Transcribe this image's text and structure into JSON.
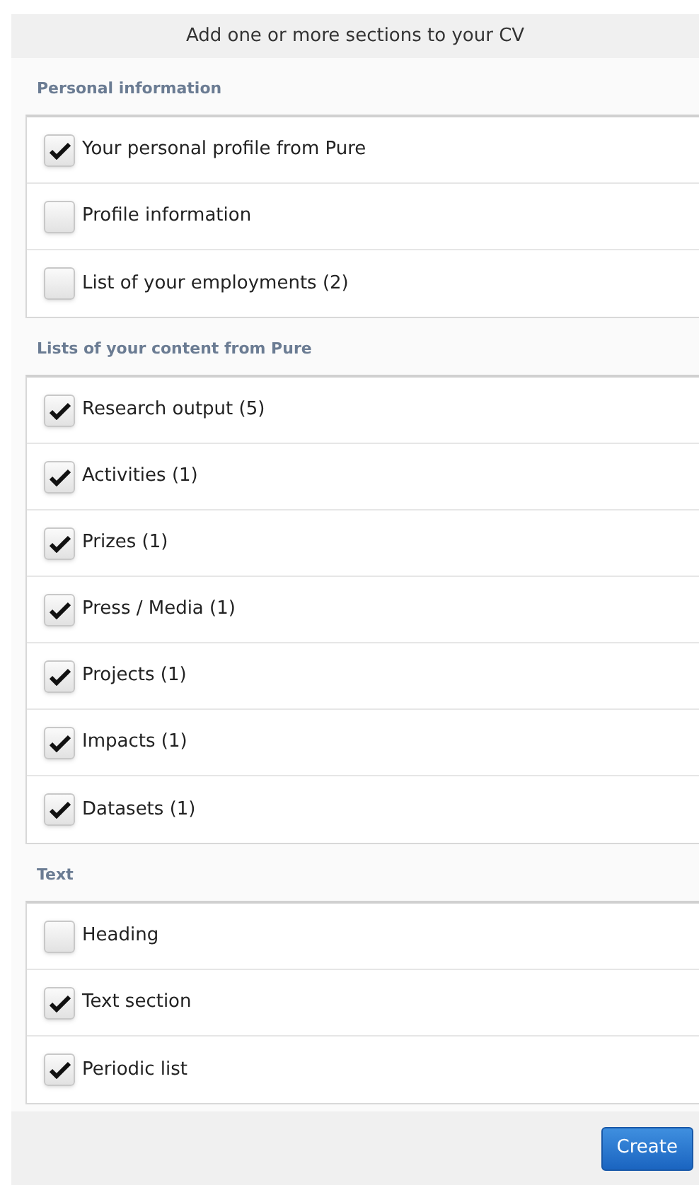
{
  "dialog": {
    "title": "Add one or more sections to your CV"
  },
  "sections": [
    {
      "heading": "Personal information",
      "items": [
        {
          "label": "Your personal profile from Pure",
          "checked": true
        },
        {
          "label": "Profile information",
          "checked": false
        },
        {
          "label": "List of your employments (2)",
          "checked": false
        }
      ]
    },
    {
      "heading": "Lists of your content from Pure",
      "items": [
        {
          "label": "Research output (5)",
          "checked": true
        },
        {
          "label": "Activities (1)",
          "checked": true
        },
        {
          "label": "Prizes (1)",
          "checked": true
        },
        {
          "label": "Press / Media (1)",
          "checked": true
        },
        {
          "label": "Projects (1)",
          "checked": true
        },
        {
          "label": "Impacts (1)",
          "checked": true
        },
        {
          "label": "Datasets (1)",
          "checked": true
        }
      ]
    },
    {
      "heading": "Text",
      "items": [
        {
          "label": "Heading",
          "checked": false
        },
        {
          "label": "Text section",
          "checked": true
        },
        {
          "label": "Periodic list",
          "checked": true
        }
      ]
    }
  ],
  "footer": {
    "button": "Create"
  }
}
